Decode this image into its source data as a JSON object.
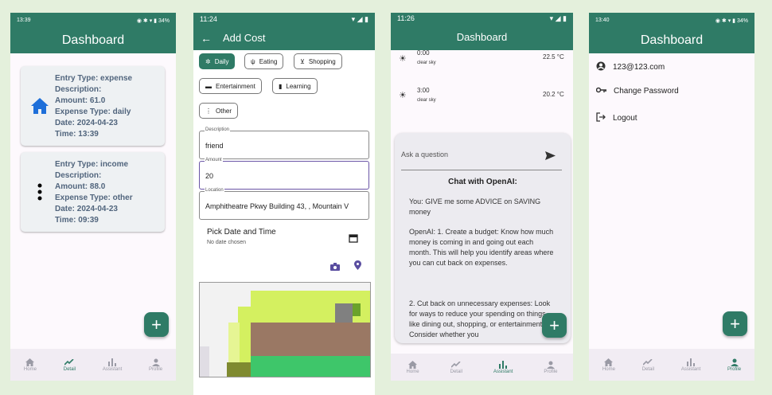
{
  "colors": {
    "primary": "#2f7b66",
    "background": "#e4f0dc"
  },
  "screen1": {
    "status_time": "13:39",
    "status_right": "34%",
    "title": "Dashboard",
    "cards": [
      {
        "icon": "home-icon",
        "lines": [
          "Entry Type: expense",
          "Description:",
          "Amount: 61.0",
          "Expense Type: daily",
          "Date: 2024-04-23",
          "Time: 13:39"
        ]
      },
      {
        "icon": "more-vert-icon",
        "lines": [
          "Entry Type: income",
          "Description:",
          "Amount: 88.0",
          "Expense Type: other",
          "Date: 2024-04-23",
          "Time: 09:39"
        ]
      }
    ],
    "fab": "+",
    "nav": [
      {
        "label": "Home",
        "icon": "home-icon"
      },
      {
        "label": "Detail",
        "icon": "trend-icon"
      },
      {
        "label": "Assistant",
        "icon": "bar-chart-icon"
      },
      {
        "label": "Profile",
        "icon": "person-icon"
      }
    ],
    "nav_active": 1
  },
  "screen2": {
    "status_time": "11:24",
    "title": "Add Cost",
    "chips": [
      {
        "label": "Daily",
        "icon": "daily-icon",
        "selected": true
      },
      {
        "label": "Eating",
        "icon": "fork-knife-icon",
        "selected": false
      },
      {
        "label": "Shopping",
        "icon": "cart-icon",
        "selected": false
      },
      {
        "label": "Entertainment",
        "icon": "tv-icon",
        "selected": false
      },
      {
        "label": "Learning",
        "icon": "book-icon",
        "selected": false
      },
      {
        "label": "Other",
        "icon": "more-vert-icon",
        "selected": false
      }
    ],
    "description": {
      "label": "Description",
      "value": "friend"
    },
    "amount": {
      "label": "Amount",
      "value": "20"
    },
    "location": {
      "label": "Location",
      "value": "Amphitheatre Pkwy Building 43, , Mountain V"
    },
    "date_title": "Pick Date and Time",
    "date_sub": "No date chosen"
  },
  "screen3": {
    "status_time": "11:26",
    "title": "Dashboard",
    "weather": [
      {
        "time": "0:00",
        "desc": "clear sky",
        "temp": "22.5 °C"
      },
      {
        "time": "3:00",
        "desc": "clear sky",
        "temp": "20.2 °C"
      }
    ],
    "ask_placeholder": "Ask a question",
    "chat_title": "Chat with OpenAI:",
    "chat_paragraphs": [
      "You: GIVE me some ADVICE on SAVING money",
      "OpenAI: 1. Create a budget: Know how much money is coming in and going out each month. This will help you identify areas where you can cut back on expenses.",
      "2. Cut back on unnecessary expenses: Look for ways to reduce your spending on things like dining out, shopping, or entertainment. Consider whether you"
    ],
    "fab": "+",
    "nav": [
      {
        "label": "Home",
        "icon": "home-icon"
      },
      {
        "label": "Detail",
        "icon": "trend-icon"
      },
      {
        "label": "Assistant",
        "icon": "bar-chart-icon"
      },
      {
        "label": "Profile",
        "icon": "person-icon"
      }
    ],
    "nav_active": 2
  },
  "screen4": {
    "status_time": "13:40",
    "status_right": "34%",
    "title": "Dashboard",
    "items": [
      {
        "icon": "account-icon",
        "label": "123@123.com"
      },
      {
        "icon": "key-icon",
        "label": "Change Password"
      },
      {
        "icon": "logout-icon",
        "label": "Logout"
      }
    ],
    "fab": "+",
    "nav": [
      {
        "label": "Home",
        "icon": "home-icon"
      },
      {
        "label": "Detail",
        "icon": "trend-icon"
      },
      {
        "label": "Assistant",
        "icon": "bar-chart-icon"
      },
      {
        "label": "Profile",
        "icon": "person-icon"
      }
    ],
    "nav_active": 3
  }
}
